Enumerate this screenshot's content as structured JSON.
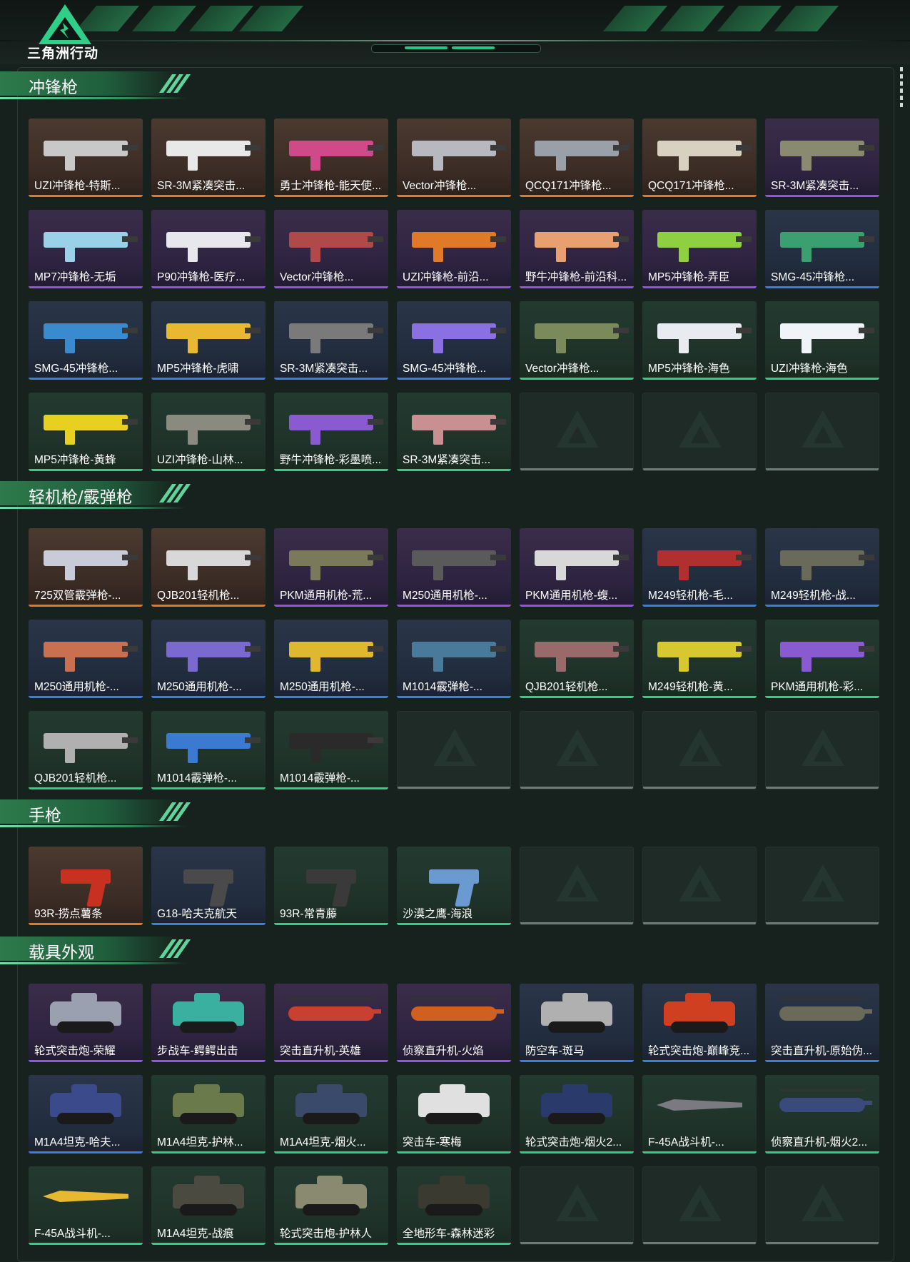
{
  "app": {
    "title": "三角洲行动"
  },
  "sections": [
    {
      "key": "smg",
      "title": "冲锋枪",
      "items": [
        {
          "name": "UZI冲锋枪-特斯...",
          "quality": "orange",
          "kind": "gun",
          "color": "#c8c8c8"
        },
        {
          "name": "SR-3M紧凑突击...",
          "quality": "orange",
          "kind": "gun",
          "color": "#e8e8e8"
        },
        {
          "name": "勇士冲锋枪-能天使...",
          "quality": "orange",
          "kind": "gun",
          "color": "#d04a8a"
        },
        {
          "name": "Vector冲锋枪...",
          "quality": "orange",
          "kind": "gun",
          "color": "#b8b8c0"
        },
        {
          "name": "QCQ171冲锋枪...",
          "quality": "orange",
          "kind": "gun",
          "color": "#9aa0a8"
        },
        {
          "name": "QCQ171冲锋枪...",
          "quality": "orange",
          "kind": "gun",
          "color": "#d8d0c0"
        },
        {
          "name": "SR-3M紧凑突击...",
          "quality": "purple",
          "kind": "gun",
          "color": "#8a8a70"
        },
        {
          "name": "MP7冲锋枪-无垢",
          "quality": "purple",
          "kind": "gun",
          "color": "#9ad0e8"
        },
        {
          "name": "P90冲锋枪-医疗...",
          "quality": "purple",
          "kind": "gun",
          "color": "#e8e8ec"
        },
        {
          "name": "Vector冲锋枪...",
          "quality": "purple",
          "kind": "gun",
          "color": "#b04a4a"
        },
        {
          "name": "UZI冲锋枪-前沿...",
          "quality": "purple",
          "kind": "gun",
          "color": "#e07a28"
        },
        {
          "name": "野牛冲锋枪-前沿科...",
          "quality": "purple",
          "kind": "gun",
          "color": "#e8a070"
        },
        {
          "name": "MP5冲锋枪-弄臣",
          "quality": "purple",
          "kind": "gun",
          "color": "#8ed040"
        },
        {
          "name": "SMG-45冲锋枪...",
          "quality": "blue",
          "kind": "gun",
          "color": "#3aa070"
        },
        {
          "name": "SMG-45冲锋枪...",
          "quality": "blue",
          "kind": "gun",
          "color": "#3a8ad0"
        },
        {
          "name": "MP5冲锋枪-虎啸",
          "quality": "blue",
          "kind": "gun",
          "color": "#e8b830"
        },
        {
          "name": "SR-3M紧凑突击...",
          "quality": "blue",
          "kind": "gun",
          "color": "#7a7a7a"
        },
        {
          "name": "SMG-45冲锋枪...",
          "quality": "blue",
          "kind": "gun",
          "color": "#8a70e0"
        },
        {
          "name": "Vector冲锋枪...",
          "quality": "green",
          "kind": "gun",
          "color": "#7a8a5a"
        },
        {
          "name": "MP5冲锋枪-海色",
          "quality": "green",
          "kind": "gun",
          "color": "#e8ecf0"
        },
        {
          "name": "UZI冲锋枪-海色",
          "quality": "green",
          "kind": "gun",
          "color": "#f0f4f8"
        },
        {
          "name": "MP5冲锋枪-黄蜂",
          "quality": "green",
          "kind": "gun",
          "color": "#e8d020"
        },
        {
          "name": "UZI冲锋枪-山林...",
          "quality": "green",
          "kind": "gun",
          "color": "#8a8a80"
        },
        {
          "name": "野牛冲锋枪-彩墨喷...",
          "quality": "green",
          "kind": "gun",
          "color": "#8a5ad0"
        },
        {
          "name": "SR-3M紧凑突击...",
          "quality": "green",
          "kind": "gun",
          "color": "#c89090"
        },
        {
          "name": "",
          "quality": "empty"
        },
        {
          "name": "",
          "quality": "empty"
        },
        {
          "name": "",
          "quality": "empty"
        }
      ]
    },
    {
      "key": "lmg",
      "title": "轻机枪/霰弹枪",
      "items": [
        {
          "name": "725双管霰弹枪-...",
          "quality": "orange",
          "kind": "gun",
          "color": "#c8ccd8"
        },
        {
          "name": "QJB201轻机枪...",
          "quality": "orange",
          "kind": "gun",
          "color": "#d8d8d8"
        },
        {
          "name": "PKM通用机枪-荒...",
          "quality": "purple",
          "kind": "gun",
          "color": "#7a7a5a"
        },
        {
          "name": "M250通用机枪-...",
          "quality": "purple",
          "kind": "gun",
          "color": "#5a5a5a"
        },
        {
          "name": "PKM通用机枪-蝮...",
          "quality": "purple",
          "kind": "gun",
          "color": "#d8d8d8"
        },
        {
          "name": "M249轻机枪-毛...",
          "quality": "blue",
          "kind": "gun",
          "color": "#b03030"
        },
        {
          "name": "M249轻机枪-战...",
          "quality": "blue",
          "kind": "gun",
          "color": "#6a6a5a"
        },
        {
          "name": "M250通用机枪-...",
          "quality": "blue",
          "kind": "gun",
          "color": "#c87050"
        },
        {
          "name": "M250通用机枪-...",
          "quality": "blue",
          "kind": "gun",
          "color": "#7a6ad0"
        },
        {
          "name": "M250通用机枪-...",
          "quality": "blue",
          "kind": "gun",
          "color": "#e0b830"
        },
        {
          "name": "M1014霰弹枪-...",
          "quality": "blue",
          "kind": "gun",
          "color": "#4a7a9a"
        },
        {
          "name": "QJB201轻机枪...",
          "quality": "green",
          "kind": "gun",
          "color": "#9a6a6a"
        },
        {
          "name": "M249轻机枪-黄...",
          "quality": "green",
          "kind": "gun",
          "color": "#d8c830"
        },
        {
          "name": "PKM通用机枪-彩...",
          "quality": "green",
          "kind": "gun",
          "color": "#8a5ad0"
        },
        {
          "name": "QJB201轻机枪...",
          "quality": "green",
          "kind": "gun",
          "color": "#b0b0b0"
        },
        {
          "name": "M1014霰弹枪-...",
          "quality": "green",
          "kind": "gun",
          "color": "#3a7ad0"
        },
        {
          "name": "M1014霰弹枪-...",
          "quality": "green",
          "kind": "gun",
          "color": "#2a2a2a"
        },
        {
          "name": "",
          "quality": "empty"
        },
        {
          "name": "",
          "quality": "empty"
        },
        {
          "name": "",
          "quality": "empty"
        },
        {
          "name": "",
          "quality": "empty"
        }
      ]
    },
    {
      "key": "pistol",
      "title": "手枪",
      "items": [
        {
          "name": "93R-捞点薯条",
          "quality": "orange",
          "kind": "pistol",
          "color": "#c83020"
        },
        {
          "name": "G18-哈夫克航天",
          "quality": "blue",
          "kind": "pistol",
          "color": "#4a4a4a"
        },
        {
          "name": "93R-常青藤",
          "quality": "green",
          "kind": "pistol",
          "color": "#3a3a3a"
        },
        {
          "name": "沙漠之鹰-海浪",
          "quality": "green",
          "kind": "pistol",
          "color": "#6a9ad0"
        },
        {
          "name": "",
          "quality": "empty"
        },
        {
          "name": "",
          "quality": "empty"
        },
        {
          "name": "",
          "quality": "empty"
        }
      ]
    },
    {
      "key": "vehicle",
      "title": "载具外观",
      "items": [
        {
          "name": "轮式突击炮-荣耀",
          "quality": "purple",
          "kind": "vehicle",
          "color": "#9aa0b0"
        },
        {
          "name": "步战车-鳄鳄出击",
          "quality": "purple",
          "kind": "vehicle",
          "color": "#3ab0a0"
        },
        {
          "name": "突击直升机-英雄",
          "quality": "purple",
          "kind": "heli",
          "color": "#c84030"
        },
        {
          "name": "侦察直升机-火焰",
          "quality": "purple",
          "kind": "heli",
          "color": "#d06020"
        },
        {
          "name": "防空车-斑马",
          "quality": "blue",
          "kind": "vehicle",
          "color": "#b0b0b0"
        },
        {
          "name": "轮式突击炮-巅峰竞...",
          "quality": "blue",
          "kind": "vehicle",
          "color": "#d04020"
        },
        {
          "name": "突击直升机-原始伪...",
          "quality": "blue",
          "kind": "heli",
          "color": "#6a6a5a"
        },
        {
          "name": "M1A4坦克-哈夫...",
          "quality": "blue",
          "kind": "vehicle",
          "color": "#3a4a8a"
        },
        {
          "name": "M1A4坦克-护林...",
          "quality": "green",
          "kind": "vehicle",
          "color": "#6a7a4a"
        },
        {
          "name": "M1A4坦克-烟火...",
          "quality": "green",
          "kind": "vehicle",
          "color": "#3a4a6a"
        },
        {
          "name": "突击车-寒梅",
          "quality": "green",
          "kind": "vehicle",
          "color": "#e0e0e0"
        },
        {
          "name": "轮式突击炮-烟火2...",
          "quality": "green",
          "kind": "vehicle",
          "color": "#2a3a6a"
        },
        {
          "name": "F-45A战斗机-...",
          "quality": "green",
          "kind": "jet",
          "color": "#7a7a80"
        },
        {
          "name": "侦察直升机-烟火2...",
          "quality": "green",
          "kind": "heli",
          "color": "#3a4a7a"
        },
        {
          "name": "F-45A战斗机-...",
          "quality": "green",
          "kind": "jet",
          "color": "#e8b830"
        },
        {
          "name": "M1A4坦克-战痕",
          "quality": "green",
          "kind": "vehicle",
          "color": "#4a4a40"
        },
        {
          "name": "轮式突击炮-护林人",
          "quality": "green",
          "kind": "vehicle",
          "color": "#8a8a70"
        },
        {
          "name": "全地形车-森林迷彩",
          "quality": "green",
          "kind": "vehicle",
          "color": "#3a3a30"
        },
        {
          "name": "",
          "quality": "empty"
        },
        {
          "name": "",
          "quality": "empty"
        },
        {
          "name": "",
          "quality": "empty"
        }
      ]
    }
  ]
}
